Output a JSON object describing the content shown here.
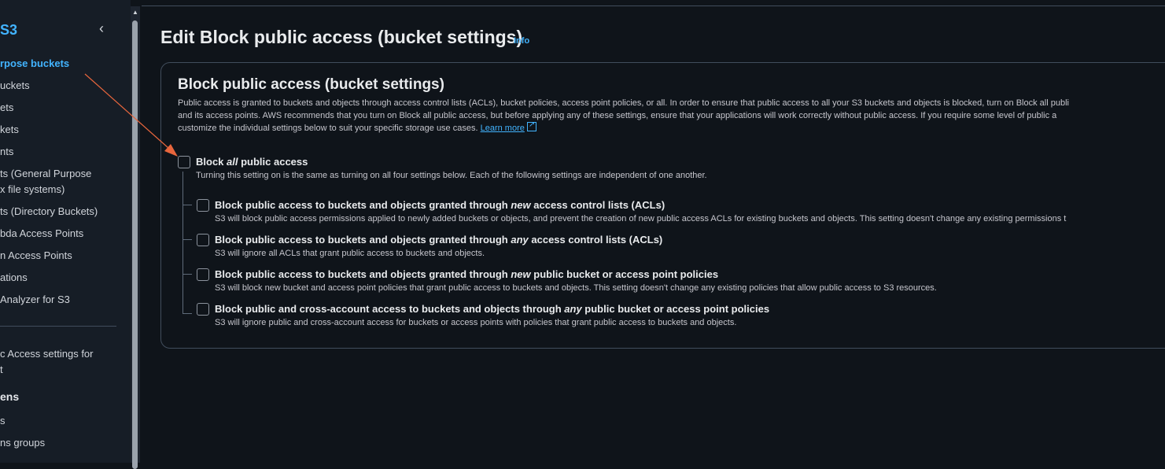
{
  "sidebar": {
    "title": "S3",
    "items": [
      {
        "label": "rpose buckets",
        "active": true
      },
      {
        "label": "uckets"
      },
      {
        "label": "ets"
      },
      {
        "label": "kets"
      },
      {
        "label": "nts"
      },
      {
        "label": "ts (General Purpose"
      },
      {
        "label": "x file systems)"
      },
      {
        "label": "ts (Directory Buckets)"
      },
      {
        "label": "bda Access Points"
      },
      {
        "label": "n Access Points"
      },
      {
        "label": "ations"
      },
      {
        "label": "Analyzer for S3"
      },
      {
        "label": "c Access settings for"
      },
      {
        "label": "t"
      },
      {
        "label": "s"
      },
      {
        "label": "ns groups"
      }
    ],
    "section": "ens"
  },
  "page": {
    "title": "Edit Block public access (bucket settings)",
    "info": "Info"
  },
  "card": {
    "title": "Block public access (bucket settings)",
    "desc_line1": "Public access is granted to buckets and objects through access control lists (ACLs), bucket policies, access point policies, or all. In order to ensure that public access to all your S3 buckets and objects is blocked, turn on Block all publi",
    "desc_line2": "and its access points. AWS recommends that you turn on Block all public access, but before applying any of these settings, ensure that your applications will work correctly without public access. If you require some level of public a",
    "desc_line3": "customize the individual settings below to suit your specific storage use cases.",
    "learn_more": "Learn more"
  },
  "block_all": {
    "label_pre": "Block ",
    "label_em": "all",
    "label_post": " public access",
    "desc": "Turning this setting on is the same as turning on all four settings below. Each of the following settings are independent of one another.",
    "checked": false
  },
  "options": [
    {
      "pre": "Block public access to buckets and objects granted through ",
      "em": "new",
      "post": " access control lists (ACLs)",
      "desc": "S3 will block public access permissions applied to newly added buckets or objects, and prevent the creation of new public access ACLs for existing buckets and objects. This setting doesn't change any existing permissions t",
      "checked": false
    },
    {
      "pre": "Block public access to buckets and objects granted through ",
      "em": "any",
      "post": " access control lists (ACLs)",
      "desc": "S3 will ignore all ACLs that grant public access to buckets and objects.",
      "checked": false
    },
    {
      "pre": "Block public access to buckets and objects granted through ",
      "em": "new",
      "post": " public bucket or access point policies",
      "desc": "S3 will block new bucket and access point policies that grant public access to buckets and objects. This setting doesn't change any existing policies that allow public access to S3 resources.",
      "checked": false
    },
    {
      "pre": "Block public and cross-account access to buckets and objects through ",
      "em": "any",
      "post": " public bucket or access point policies",
      "desc": "S3 will ignore public and cross-account access for buckets or access points with policies that grant public access to buckets and objects.",
      "checked": false
    }
  ],
  "colors": {
    "accent": "#42b4ff",
    "annotation_arrow": "#e8663d",
    "background": "#0f141a"
  }
}
